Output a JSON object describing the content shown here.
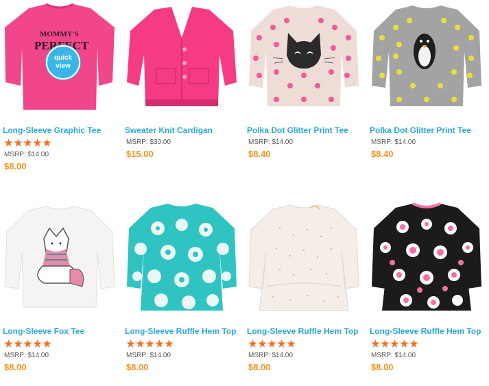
{
  "products": [
    {
      "name": "Long-Sleeve Graphic Tee",
      "msrp": "MSRP: $14.00",
      "price": "$8.00",
      "rating": 5,
      "shirt_print": "MOMMY'S PERFECT",
      "quick_view": "quick view"
    },
    {
      "name": "Sweater Knit Cardigan",
      "msrp": "MSRP: $30.00",
      "price": "$15.00",
      "rating": 0
    },
    {
      "name": "Polka Dot Glitter Print Tee",
      "msrp": "MSRP: $14.00",
      "price": "$8.40",
      "rating": 0
    },
    {
      "name": "Polka Dot Glitter Print Tee",
      "msrp": "MSRP: $14.00",
      "price": "$8.40",
      "rating": 0
    },
    {
      "name": "Long-Sleeve Fox Tee",
      "msrp": "MSRP: $14.00",
      "price": "$8.00",
      "rating": 5
    },
    {
      "name": "Long-Sleeve Ruffle Hem Top",
      "msrp": "MSRP: $14.00",
      "price": "$8.00",
      "rating": 5
    },
    {
      "name": "Long-Sleeve Ruffle Hem Top",
      "msrp": "MSRP: $14.00",
      "price": "$8.00",
      "rating": 5
    },
    {
      "name": "Long-Sleeve Ruffle Hem Top",
      "msrp": "MSRP: $14.00",
      "price": "$8.00",
      "rating": 5
    }
  ],
  "colors": {
    "link": "#2aa7d6",
    "price": "#f7931e",
    "star": "#f36f21",
    "quick_view": "#38b6e8"
  }
}
